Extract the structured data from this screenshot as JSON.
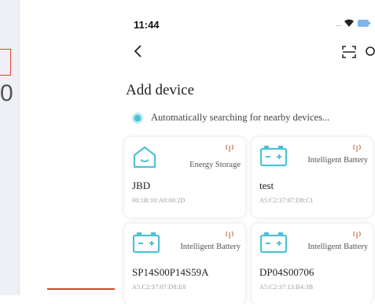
{
  "status_bar": {
    "time": "11:44",
    "signal": "...."
  },
  "page": {
    "title": "Add device",
    "search_status": "Automatically searching for nearby devices..."
  },
  "devices": [
    {
      "type": "Energy Storage",
      "name": "JBD",
      "mac": "00:1B:10:A0:00:2D",
      "icon": "home-battery-icon"
    },
    {
      "type": "Intelligent Battery",
      "name": "test",
      "mac": "A5:C2:37:07:D8:C1",
      "icon": "battery-icon"
    },
    {
      "type": "Intelligent Battery",
      "name": "SP14S00P14S59A",
      "mac": "A5:C2:37:07:D8:E8",
      "icon": "battery-icon"
    },
    {
      "type": "Intelligent Battery",
      "name": "DP04S00706",
      "mac": "A5:C2:37:13:B4:3B",
      "icon": "battery-icon"
    }
  ],
  "colors": {
    "accent": "#4ec2d4",
    "annotation": "#d8432e"
  },
  "left_panel": {
    "partial_glyph": "0"
  }
}
